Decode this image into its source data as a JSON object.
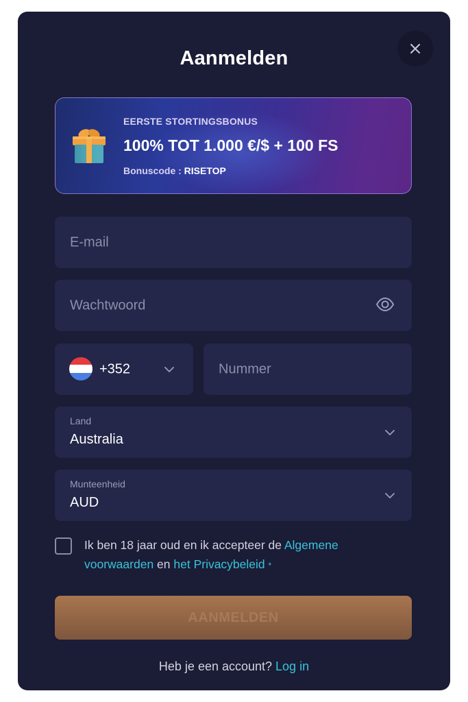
{
  "modal": {
    "title": "Aanmelden",
    "close_icon": "close-icon"
  },
  "bonus": {
    "icon": "gift-icon",
    "kicker": "EERSTE STORTINGSBONUS",
    "headline": "100% TOT 1.000 €/$ + 100 FS",
    "code_label": "Bonuscode : ",
    "code_value": "RISETOP"
  },
  "form": {
    "email": {
      "placeholder": "E-mail",
      "value": ""
    },
    "password": {
      "placeholder": "Wachtwoord",
      "value": "",
      "toggle_icon": "eye-icon"
    },
    "phone": {
      "country_flag": "flag-netherlands-icon",
      "code": "+352",
      "number_placeholder": "Nummer",
      "number_value": ""
    },
    "country": {
      "label": "Land",
      "value": "Australia"
    },
    "currency": {
      "label": "Munteenheid",
      "value": "AUD"
    },
    "terms": {
      "text_before": "Ik ben 18 jaar oud en ik accepteer de ",
      "link_terms": "Algemene voorwaarden",
      "text_middle": " en ",
      "link_privacy": "het Privacybeleid",
      "required_mark": "*",
      "checked": false
    },
    "submit_label": "AANMELDEN"
  },
  "footer": {
    "question": "Heb je een account? ",
    "login_link": "Log in"
  },
  "colors": {
    "background": "#1b1c35",
    "field": "#24264a",
    "accent_link": "#38c3dc",
    "submit": "#9a6b48"
  }
}
